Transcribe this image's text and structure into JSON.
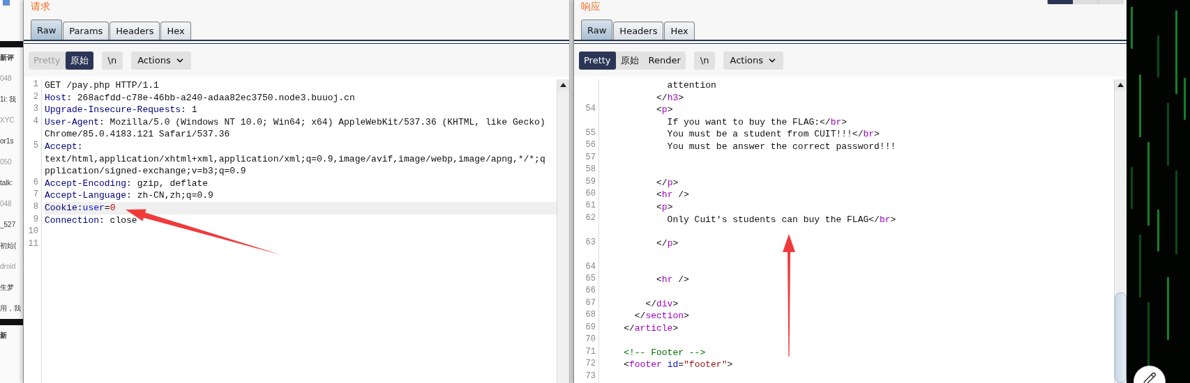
{
  "background_page": {
    "fragments": [
      {
        "kind": "heading",
        "text": "新评"
      },
      {
        "kind": "muted",
        "text": "048"
      },
      {
        "kind": "normal",
        "text": "1i: 我"
      },
      {
        "kind": "muted",
        "text": "XYC"
      },
      {
        "kind": "normal",
        "text": "or1s"
      },
      {
        "kind": "muted",
        "text": "050"
      },
      {
        "kind": "normal",
        "text": "talk:"
      },
      {
        "kind": "muted",
        "text": "048"
      },
      {
        "kind": "normal",
        "text": "_527"
      },
      {
        "kind": "normal",
        "text": "初始("
      },
      {
        "kind": "muted",
        "text": "droid"
      },
      {
        "kind": "normal",
        "text": "生梦"
      },
      {
        "kind": "normal",
        "text": "用，我"
      },
      {
        "kind": "heading",
        "text": "新"
      }
    ]
  },
  "request": {
    "title": "请求",
    "tabs": [
      {
        "label": "Raw",
        "selected": true
      },
      {
        "label": "Params",
        "selected": false
      },
      {
        "label": "Headers",
        "selected": false
      },
      {
        "label": "Hex",
        "selected": false
      }
    ],
    "view_modes": [
      {
        "label": "Pretty",
        "selected": false,
        "disabled": true
      },
      {
        "label": "原始",
        "selected": true,
        "disabled": false
      }
    ],
    "newline_button": "\\n",
    "actions_button": "Actions",
    "rows": [
      {
        "number": "1",
        "highlighted": false,
        "tokens": [
          {
            "kind": "plain",
            "text": "GET /pay.php HTTP/1.1"
          }
        ]
      },
      {
        "number": "2",
        "highlighted": false,
        "tokens": [
          {
            "kind": "header",
            "text": "Host"
          },
          {
            "kind": "plain",
            "text": ": 268acfdd-c78e-46bb-a240-adaa82ec3750.node3.buuoj.cn"
          }
        ]
      },
      {
        "number": "3",
        "highlighted": false,
        "tokens": [
          {
            "kind": "header",
            "text": "Upgrade-Insecure-Requests"
          },
          {
            "kind": "plain",
            "text": ": 1"
          }
        ]
      },
      {
        "number": "4",
        "highlighted": false,
        "tokens": [
          {
            "kind": "header",
            "text": "User-Agent"
          },
          {
            "kind": "plain",
            "text": ": Mozilla/5.0 (Windows NT 10.0; Win64; x64) AppleWebKit/537.36 (KHTML, like Gecko)"
          }
        ]
      },
      {
        "highlighted": false,
        "tokens": [
          {
            "kind": "plain",
            "text": "Chrome/85.0.4183.121 Safari/537.36"
          }
        ]
      },
      {
        "number": "5",
        "highlighted": false,
        "tokens": [
          {
            "kind": "header",
            "text": "Accept"
          },
          {
            "kind": "plain",
            "text": ":"
          }
        ]
      },
      {
        "highlighted": false,
        "tokens": [
          {
            "kind": "plain",
            "text": "text/html,application/xhtml+xml,application/xml;q=0.9,image/avif,image/webp,image/apng,*/*;q"
          }
        ]
      },
      {
        "highlighted": false,
        "tokens": [
          {
            "kind": "plain",
            "text": "pplication/signed-exchange;v=b3;q=0.9"
          }
        ]
      },
      {
        "number": "6",
        "highlighted": false,
        "tokens": [
          {
            "kind": "header",
            "text": "Accept-Encoding"
          },
          {
            "kind": "plain",
            "text": ": gzip, deflate"
          }
        ]
      },
      {
        "number": "7",
        "highlighted": false,
        "tokens": [
          {
            "kind": "header",
            "text": "Accept-Language"
          },
          {
            "kind": "plain",
            "text": ": zh-CN,zh;q=0.9"
          }
        ]
      },
      {
        "number": "8",
        "highlighted": true,
        "tokens": [
          {
            "kind": "header",
            "text": "Cookie:"
          },
          {
            "kind": "key",
            "text": "user"
          },
          {
            "kind": "plain",
            "text": "="
          },
          {
            "kind": "value",
            "text": "0"
          }
        ]
      },
      {
        "number": "9",
        "highlighted": false,
        "tokens": [
          {
            "kind": "header",
            "text": "Connection"
          },
          {
            "kind": "plain",
            "text": ": close"
          }
        ]
      },
      {
        "number": "10",
        "highlighted": false
      },
      {
        "number": "11",
        "highlighted": false
      }
    ]
  },
  "response": {
    "title": "响应",
    "tabs": [
      {
        "label": "Raw",
        "selected": true
      },
      {
        "label": "Headers",
        "selected": false
      },
      {
        "label": "Hex",
        "selected": false
      }
    ],
    "view_modes": [
      {
        "label": "Pretty",
        "selected": true,
        "disabled": false
      },
      {
        "label": "原始",
        "selected": false,
        "disabled": false
      },
      {
        "label": "Render",
        "selected": false,
        "disabled": false
      }
    ],
    "newline_button": "\\n",
    "actions_button": "Actions",
    "rows": [
      {
        "tokens": [
          {
            "kind": "plain",
            "text": "            attention"
          }
        ]
      },
      {
        "tokens": [
          {
            "kind": "plain",
            "text": "          </"
          },
          {
            "kind": "tag",
            "text": "h3"
          },
          {
            "kind": "plain",
            "text": ">"
          }
        ]
      },
      {
        "number": "54",
        "tokens": [
          {
            "kind": "plain",
            "text": "          <"
          },
          {
            "kind": "tag",
            "text": "p"
          },
          {
            "kind": "plain",
            "text": ">"
          }
        ]
      },
      {
        "tokens": [
          {
            "kind": "plain",
            "text": "            If you want to buy the FLAG:</"
          },
          {
            "kind": "tag",
            "text": "br"
          },
          {
            "kind": "plain",
            "text": ">"
          }
        ]
      },
      {
        "number": "55",
        "tokens": [
          {
            "kind": "plain",
            "text": "            You must be a student from CUIT!!!</"
          },
          {
            "kind": "tag",
            "text": "br"
          },
          {
            "kind": "plain",
            "text": ">"
          }
        ]
      },
      {
        "number": "56",
        "tokens": [
          {
            "kind": "plain",
            "text": "            You must be answer the correct password!!!"
          }
        ]
      },
      {
        "number": "57"
      },
      {
        "number": "58"
      },
      {
        "number": "59",
        "tokens": [
          {
            "kind": "plain",
            "text": "          </"
          },
          {
            "kind": "tag",
            "text": "p"
          },
          {
            "kind": "plain",
            "text": ">"
          }
        ]
      },
      {
        "number": "60",
        "tokens": [
          {
            "kind": "plain",
            "text": "          <"
          },
          {
            "kind": "tag",
            "text": "hr"
          },
          {
            "kind": "plain",
            "text": " />"
          }
        ]
      },
      {
        "number": "61",
        "tokens": [
          {
            "kind": "plain",
            "text": "          <"
          },
          {
            "kind": "tag",
            "text": "p"
          },
          {
            "kind": "plain",
            "text": ">"
          }
        ]
      },
      {
        "number": "62",
        "tokens": [
          {
            "kind": "plain",
            "text": "            Only Cuit's students can buy the FLAG</"
          },
          {
            "kind": "tag",
            "text": "br"
          },
          {
            "kind": "plain",
            "text": ">"
          }
        ]
      },
      {},
      {
        "number": "63",
        "tokens": [
          {
            "kind": "plain",
            "text": "          </"
          },
          {
            "kind": "tag",
            "text": "p"
          },
          {
            "kind": "plain",
            "text": ">"
          }
        ]
      },
      {},
      {
        "number": "64"
      },
      {
        "number": "65",
        "tokens": [
          {
            "kind": "plain",
            "text": "          <"
          },
          {
            "kind": "tag",
            "text": "hr"
          },
          {
            "kind": "plain",
            "text": " />"
          }
        ]
      },
      {
        "number": "66"
      },
      {
        "number": "67",
        "tokens": [
          {
            "kind": "plain",
            "text": "        </"
          },
          {
            "kind": "tag",
            "text": "div"
          },
          {
            "kind": "plain",
            "text": ">"
          }
        ]
      },
      {
        "number": "68",
        "tokens": [
          {
            "kind": "plain",
            "text": "      </"
          },
          {
            "kind": "tag",
            "text": "section"
          },
          {
            "kind": "plain",
            "text": ">"
          }
        ]
      },
      {
        "number": "69",
        "tokens": [
          {
            "kind": "plain",
            "text": "    </"
          },
          {
            "kind": "tag",
            "text": "article"
          },
          {
            "kind": "plain",
            "text": ">"
          }
        ]
      },
      {
        "number": "70"
      },
      {
        "number": "71",
        "tokens": [
          {
            "kind": "comment",
            "text": "    <!-- Footer -->"
          }
        ]
      },
      {
        "number": "72",
        "tokens": [
          {
            "kind": "plain",
            "text": "    <"
          },
          {
            "kind": "tag",
            "text": "footer"
          },
          {
            "kind": "attr",
            "text": " id"
          },
          {
            "kind": "plain",
            "text": "="
          },
          {
            "kind": "string",
            "text": "\"footer\""
          },
          {
            "kind": "plain",
            "text": ">"
          }
        ]
      },
      {
        "number": "73"
      }
    ]
  }
}
